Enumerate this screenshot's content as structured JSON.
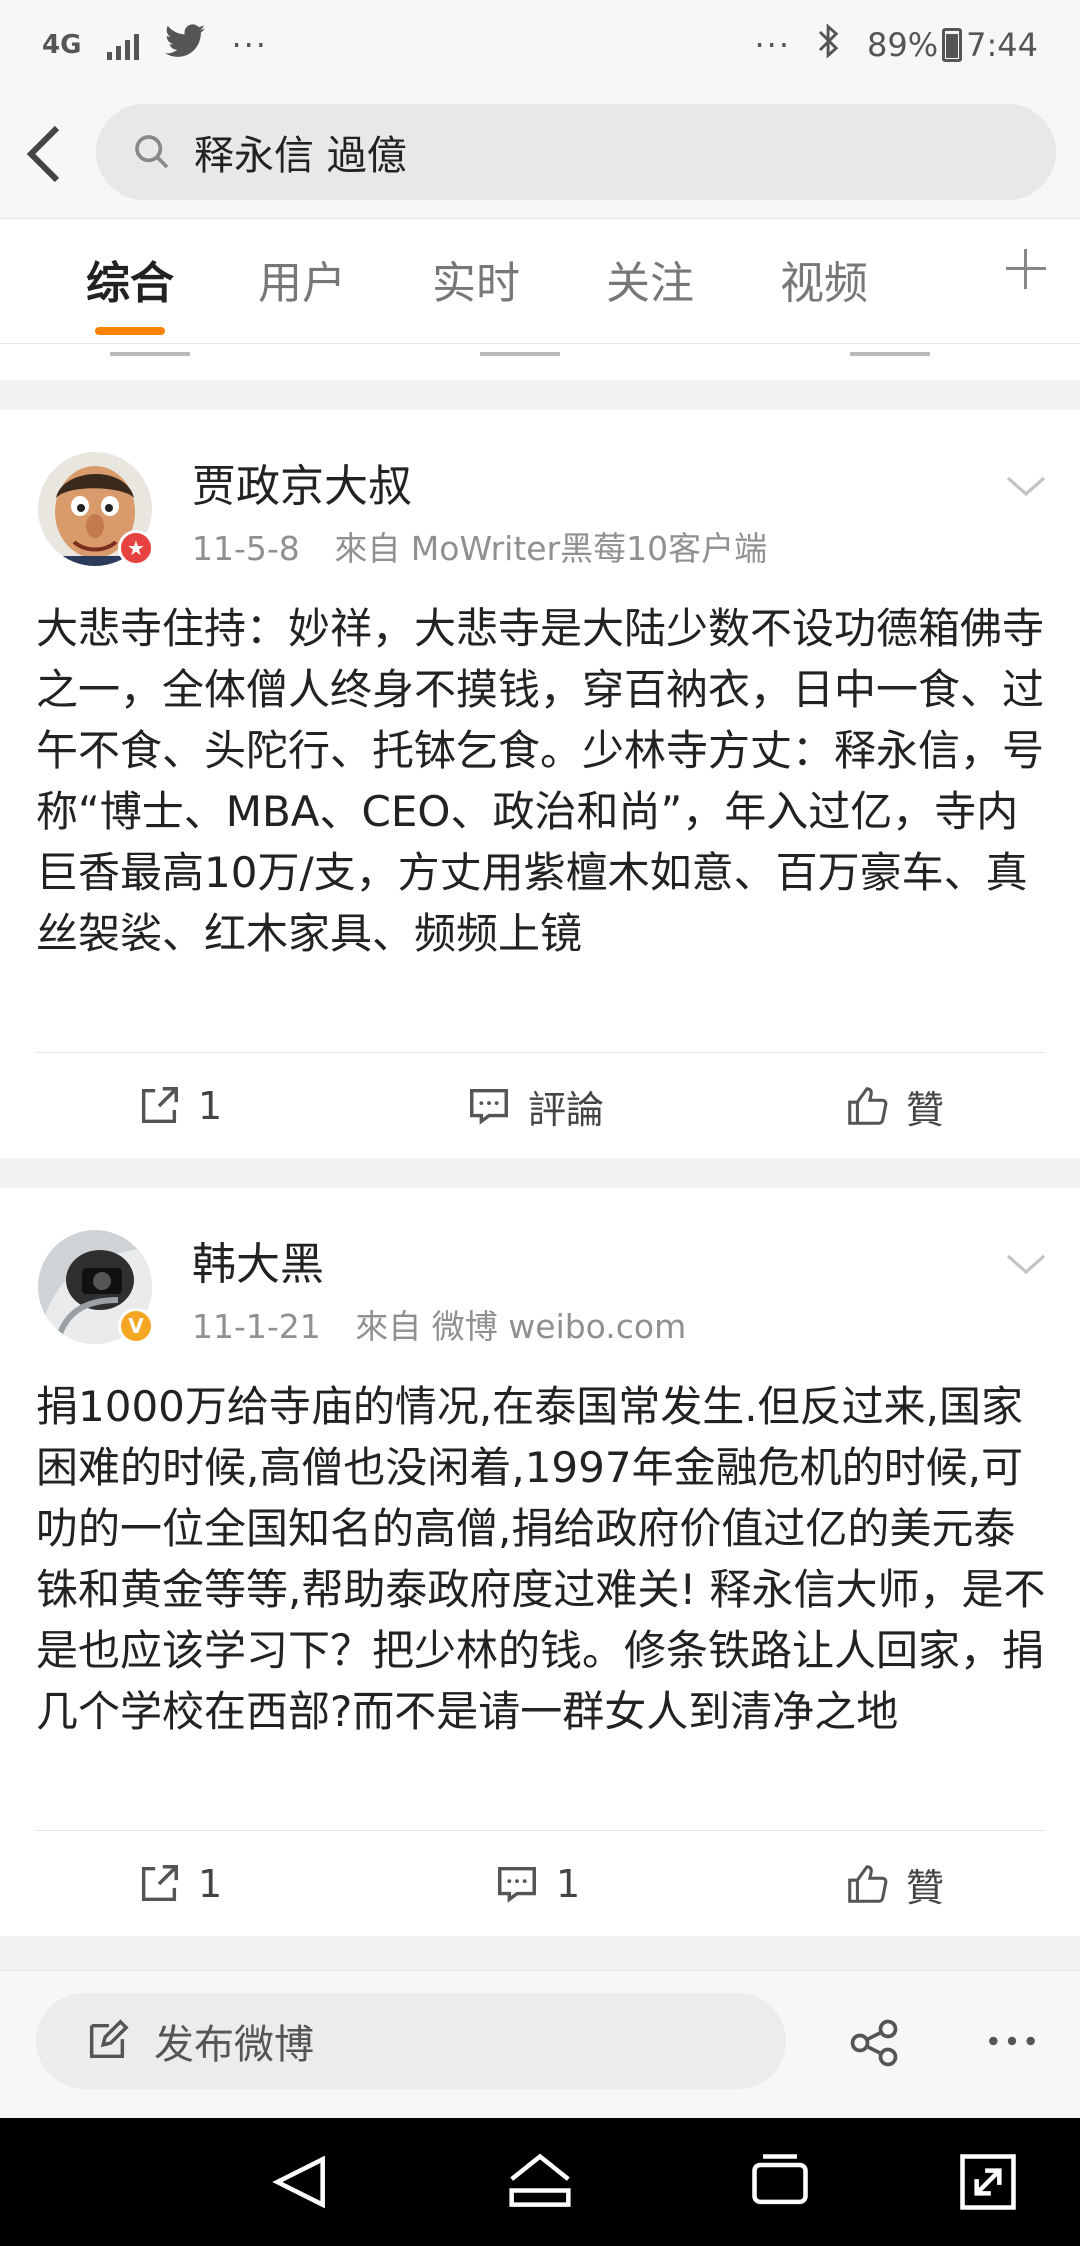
{
  "status_bar": {
    "network": "4G",
    "overflow": "···",
    "battery": "89%",
    "time": "7:44",
    "left_icons": [
      "signal-icon",
      "twitter-icon"
    ],
    "right_icons": [
      "bluetooth-icon",
      "battery-icon"
    ]
  },
  "search": {
    "query": "释永信 過億"
  },
  "tabs": [
    {
      "label": "综合",
      "active": true
    },
    {
      "label": "用户",
      "active": false
    },
    {
      "label": "实时",
      "active": false
    },
    {
      "label": "关注",
      "active": false
    },
    {
      "label": "视频",
      "active": false
    }
  ],
  "posts": [
    {
      "username": "贾政京大叔",
      "date": "11-5-8",
      "source": "來自 MoWriter黑莓10客户端",
      "badge_color": "#e64340",
      "text": "大悲寺住持：妙祥，大悲寺是大陆少数不设功德箱佛寺之一，全体僧人终身不摸钱，穿百衲衣，日中一食、过午不食、头陀行、托钵乞食。少林寺方丈：释永信，号称“博士、MBA、CEO、政治和尚”，年入过亿，寺内巨香最高10万/支，方丈用紫檀木如意、百万豪车、真丝袈裟、红木家具、频频上镜",
      "repost_count": "1",
      "comment_label": "評論",
      "like_label": "贊"
    },
    {
      "username": "韩大黑",
      "date": "11-1-21",
      "source": "來自 微博 weibo.com",
      "badge_color": "#f5a623",
      "text": "捐1000万给寺庙的情况,在泰国常发生.但反过来,国家困难的时候,高僧也没闲着,1997年金融危机的时候,可叻的一位全国知名的高僧,捐给政府价值过亿的美元泰铢和黄金等等,帮助泰政府度过难关! 释永信大师，是不是也应该学习下？把少林的钱。修条铁路让人回家，捐几个学校在西部?而不是请一群女人到清净之地",
      "repost_count": "1",
      "comment_label": "1",
      "like_label": "贊"
    }
  ],
  "compose": {
    "label": "发布微博"
  },
  "colors": {
    "accent": "#ff8200",
    "text_secondary": "#909090"
  }
}
